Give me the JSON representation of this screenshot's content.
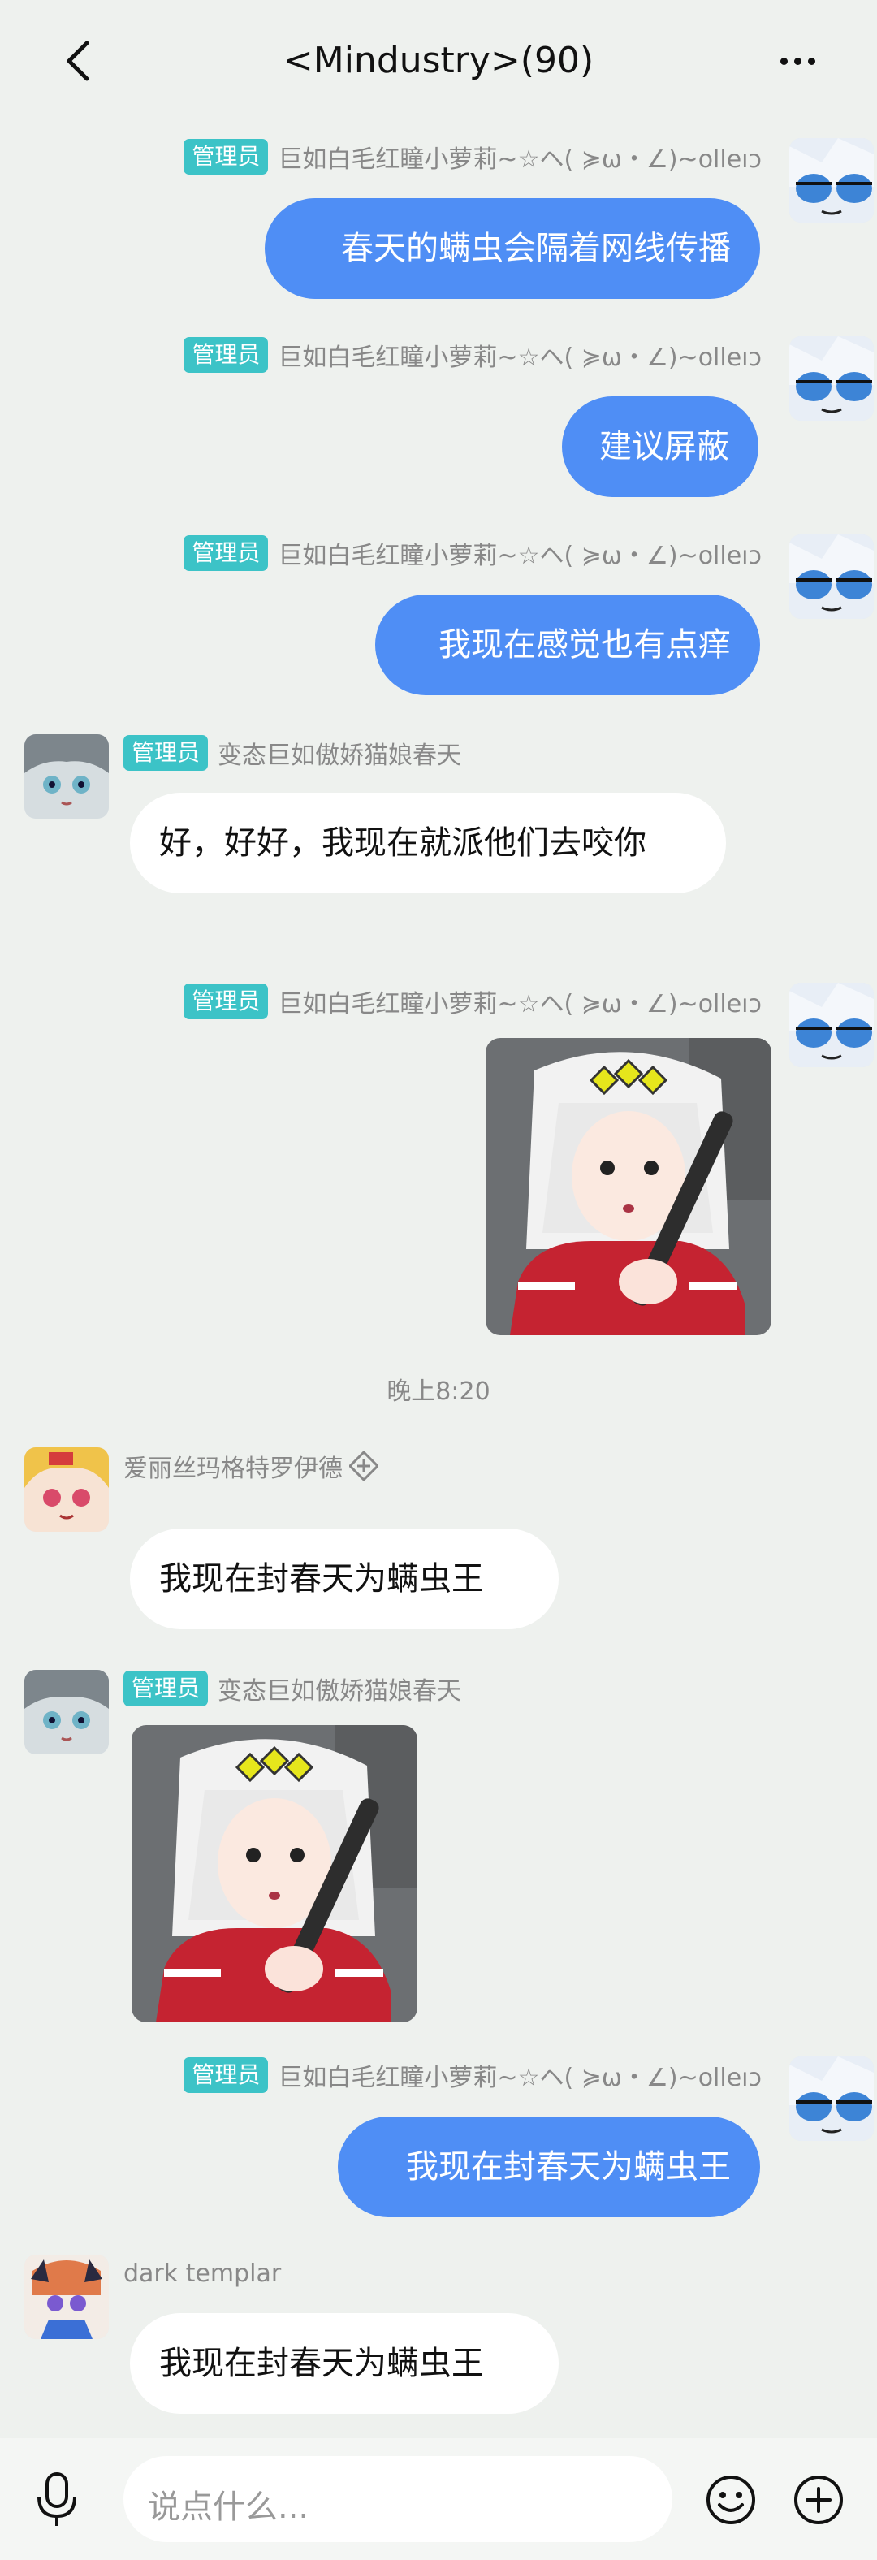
{
  "header": {
    "title": "<Mindustry>(90)"
  },
  "messages": [
    {
      "badge": "管理员",
      "nick": "巨如白毛红瞳小萝莉~☆ヘ( ≽ω・∠)~olleıɔ",
      "text": "春天的螨虫会隔着网线传播"
    },
    {
      "badge": "管理员",
      "nick": "巨如白毛红瞳小萝莉~☆ヘ( ≽ω・∠)~olleıɔ",
      "text": "建议屏蔽"
    },
    {
      "badge": "管理员",
      "nick": "巨如白毛红瞳小萝莉~☆ヘ( ≽ω・∠)~olleıɔ",
      "text": "我现在感觉也有点痒"
    },
    {
      "badge": "管理员",
      "nick": "变态巨如傲娇猫娘春天",
      "text": "好，好好，我现在就派他们去咬你"
    },
    {
      "badge": "管理员",
      "nick": "巨如白毛红瞳小萝莉~☆ヘ( ≽ω・∠)~olleıɔ"
    },
    {
      "time": "晚上8:20"
    },
    {
      "nick": "爱丽丝玛格特罗伊德",
      "text": "我现在封春天为螨虫王"
    },
    {
      "badge": "管理员",
      "nick": "变态巨如傲娇猫娘春天"
    },
    {
      "badge": "管理员",
      "nick": "巨如白毛红瞳小萝莉~☆ヘ( ≽ω・∠)~olleıɔ",
      "text": "我现在封春天为螨虫王"
    },
    {
      "nick": "dark templar",
      "text": "我现在封春天为螨虫王"
    }
  ],
  "input": {
    "placeholder": "说点什么..."
  },
  "colors": {
    "my_bubble": "#4f8ef5",
    "badge": "#3cc3c7",
    "background": "#eef1ee"
  }
}
